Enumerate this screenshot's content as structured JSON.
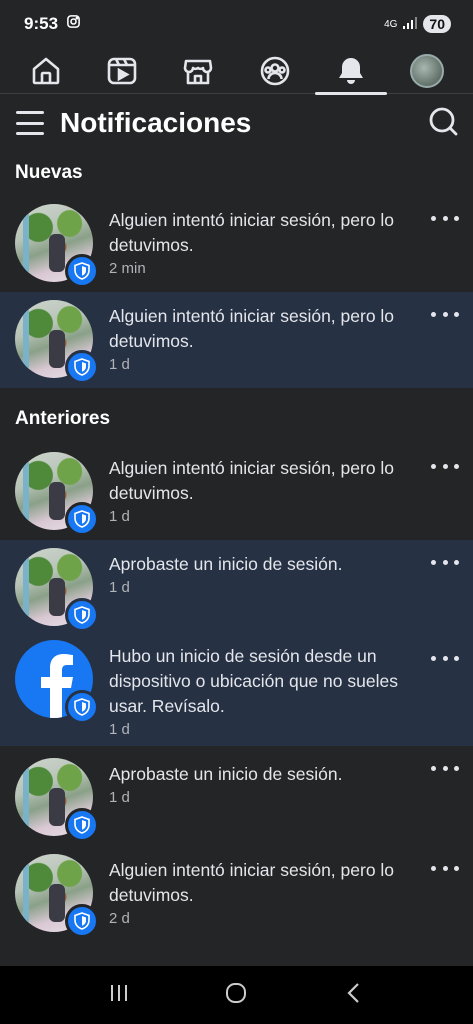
{
  "status": {
    "time": "9:53",
    "network": "4G",
    "battery": "70"
  },
  "tabs": [
    {
      "name": "home",
      "icon": "home-icon"
    },
    {
      "name": "watch",
      "icon": "video-icon"
    },
    {
      "name": "marketplace",
      "icon": "store-icon"
    },
    {
      "name": "groups",
      "icon": "groups-icon"
    },
    {
      "name": "notifications",
      "icon": "bell-icon",
      "active": true
    },
    {
      "name": "profile",
      "icon": "avatar"
    }
  ],
  "header": {
    "title": "Notificaciones"
  },
  "sections": {
    "new_label": "Nuevas",
    "earlier_label": "Anteriores"
  },
  "notifications": [
    {
      "text": "Alguien intentó iniciar sesión, pero lo detuvimos.",
      "time": "2 min"
    },
    {
      "text": "Alguien intentó iniciar sesión, pero lo detuvimos.",
      "time": "1 d"
    },
    {
      "text": "Alguien intentó iniciar sesión, pero lo detuvimos.",
      "time": "1 d"
    },
    {
      "text": "Aprobaste un inicio de sesión.",
      "time": "1 d"
    },
    {
      "text": "Hubo un inicio de sesión desde un dispositivo o ubicación que no sueles usar. Revísalo.",
      "time": "1 d"
    },
    {
      "text": "Aprobaste un inicio de sesión.",
      "time": "1 d"
    },
    {
      "text": "Alguien intentó iniciar sesión, pero lo detuvimos.",
      "time": "2 d"
    }
  ],
  "colors": {
    "background": "#242526",
    "unread": "#263144",
    "accent": "#1877f2"
  }
}
